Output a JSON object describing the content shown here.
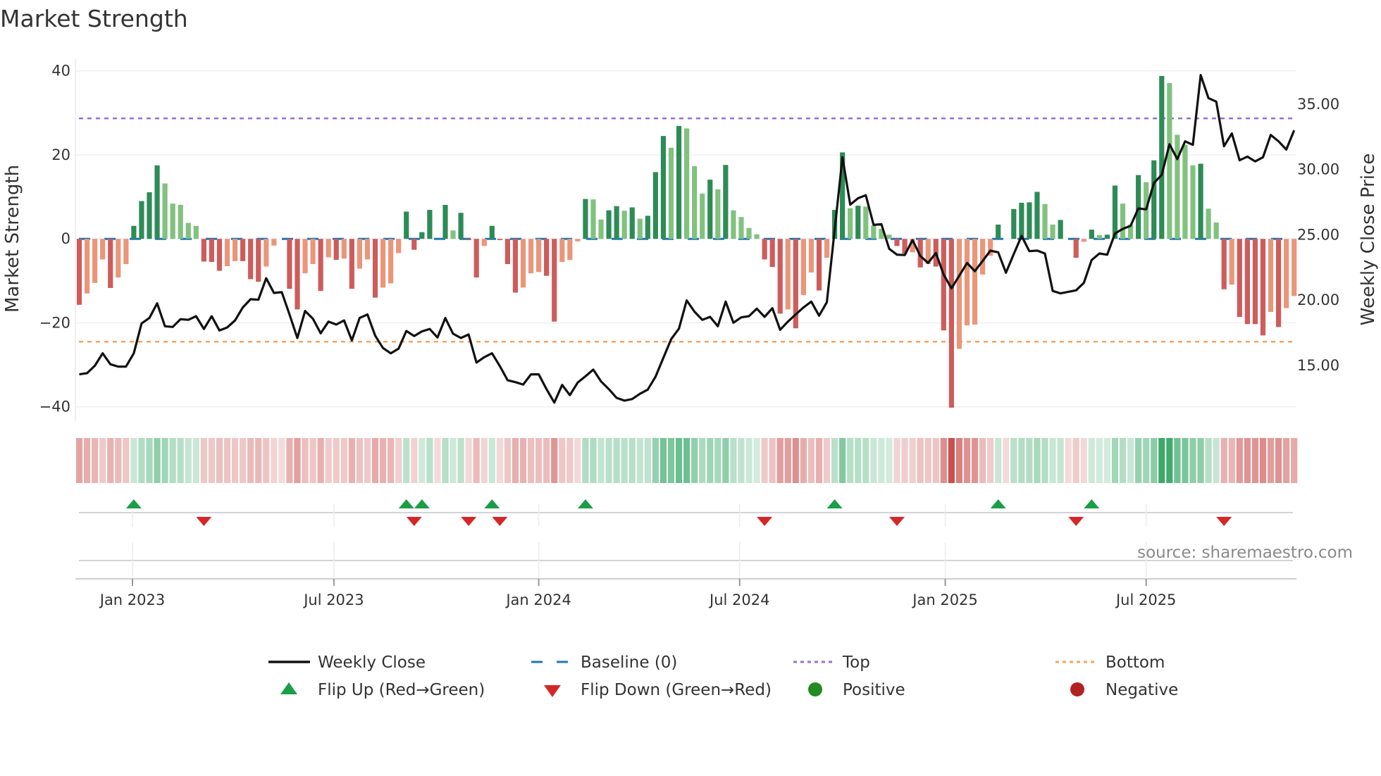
{
  "title": "Market Strength",
  "source": "source: sharemaestro.com",
  "colors": {
    "green_strong": "#2e8b57",
    "green_weak": "#82c17f",
    "red_strong": "#cd5c5c",
    "red_weak": "#e9967a",
    "baseline": "#1f77b4",
    "top": "#9370db",
    "bottom": "#f4a460",
    "close": "#111111",
    "flip_up": "#1a9e46",
    "flip_down": "#d62728",
    "positive": "#228b22",
    "negative": "#b22222",
    "strip_green": "#2ca25f",
    "strip_red": "#c84646"
  },
  "legend": {
    "weekly_close": "Weekly Close",
    "baseline": "Baseline (0)",
    "top": "Top",
    "bottom": "Bottom",
    "flip_up": "Flip Up (Red→Green)",
    "flip_down": "Flip Down (Green→Red)",
    "positive": "Positive",
    "negative": "Negative"
  },
  "chart_data": {
    "type": "bar",
    "title": "Market Strength",
    "ylabel": "Market Strength",
    "ylabel_right": "Weekly Close Price",
    "xlabel": "",
    "ylim": [
      -43.4,
      42.8
    ],
    "ylim_right": [
      10.74,
      38.45
    ],
    "xlim_weeks": [
      -0.5,
      156.3
    ],
    "yticks": [
      {
        "v": 40,
        "label": "40"
      },
      {
        "v": 20,
        "label": "20"
      },
      {
        "v": 0,
        "label": "0"
      },
      {
        "v": -20,
        "label": "−20"
      },
      {
        "v": -40,
        "label": "−40"
      }
    ],
    "yticks_right": [
      {
        "v": 15,
        "label": "15.00"
      },
      {
        "v": 20,
        "label": "20.00"
      },
      {
        "v": 25,
        "label": "25.00"
      },
      {
        "v": 30,
        "label": "30.00"
      },
      {
        "v": 35,
        "label": "35.00"
      }
    ],
    "xticks": [
      {
        "week": 6.83,
        "label": "Jan 2023"
      },
      {
        "week": 32.7,
        "label": "Jul 2023"
      },
      {
        "week": 59,
        "label": "Jan 2024"
      },
      {
        "week": 84.8,
        "label": "Jul 2024"
      },
      {
        "week": 111.2,
        "label": "Jan 2025"
      },
      {
        "week": 137,
        "label": "Jul 2025"
      }
    ],
    "top_level": 28.7,
    "bottom_level": -24.5,
    "baseline": 0,
    "grid": true,
    "legend_position": "bottom",
    "strength": [
      -15.7,
      -13,
      -10.5,
      -4.9,
      -11.7,
      -9.2,
      -6,
      3.1,
      9,
      11.1,
      17.5,
      13.2,
      8.4,
      8.1,
      3.8,
      3.1,
      -5.4,
      -5.5,
      -7.6,
      -6.5,
      -5.3,
      -5.3,
      -9.6,
      -10.2,
      -6.6,
      -1.6,
      0,
      -11.9,
      -16.8,
      -8.2,
      -6,
      -12.4,
      -4.4,
      -5,
      -4.7,
      -11.9,
      -7.1,
      -4.9,
      -14,
      -11.6,
      -10.6,
      -3.4,
      6.5,
      -2.6,
      1.6,
      6.9,
      0,
      8.1,
      2,
      6.2,
      -0.3,
      -9.2,
      -1.7,
      3.1,
      -0.3,
      -6,
      -12.8,
      -11.6,
      -8.2,
      -7.9,
      -8.8,
      -19.7,
      -5.5,
      -5,
      -0.6,
      9.5,
      9.4,
      4.6,
      6.8,
      7.8,
      6.7,
      7.5,
      4.8,
      5.5,
      15.9,
      24.5,
      21.7,
      26.9,
      26.3,
      17.3,
      10.8,
      14.1,
      11.8,
      17.6,
      6.8,
      5.2,
      2.6,
      1.1,
      -4.9,
      -6.7,
      -17.8,
      -16.8,
      -21.3,
      -13.4,
      -8,
      -12.3,
      -4.5,
      6.9,
      20.6,
      7.3,
      7.9,
      7.7,
      3.2,
      2.4,
      1,
      -1.7,
      -3.5,
      -3.2,
      -6.8,
      -6,
      -6.6,
      -21.8,
      -40.2,
      -26.2,
      -20.6,
      -20.4,
      -8.5,
      -4,
      3.4,
      0,
      7.1,
      8.6,
      8.7,
      11.2,
      8.3,
      3.4,
      4.5,
      0,
      -4.5,
      -0.7,
      2.2,
      0.9,
      1,
      12.7,
      8.4,
      3.4,
      15.2,
      13.5,
      18.7,
      38.8,
      37.1,
      24.8,
      22.4,
      17.5,
      17.9,
      7.2,
      3.9,
      -12,
      -10.9,
      -18.6,
      -20.3,
      -20.3,
      -23,
      -17.4,
      -21,
      -16.5,
      -13.6
    ],
    "weekly_close": [
      14.32,
      14.41,
      14.98,
      15.93,
      15.09,
      14.91,
      14.91,
      15.93,
      18.22,
      18.63,
      19.76,
      18.0,
      17.95,
      18.54,
      18.49,
      18.77,
      17.79,
      18.77,
      17.68,
      17.91,
      18.45,
      19.44,
      20.07,
      20.03,
      21.68,
      20.55,
      20.61,
      18.9,
      17.1,
      19.17,
      18.58,
      17.46,
      18.36,
      18.13,
      18.45,
      16.92,
      18.63,
      18.9,
      17.28,
      16.33,
      15.93,
      16.29,
      17.64,
      17.25,
      17.61,
      17.79,
      17.14,
      18.63,
      17.43,
      17.1,
      17.37,
      15.22,
      15.63,
      15.93,
      14.95,
      13.87,
      13.72,
      13.54,
      14.32,
      14.32,
      13.18,
      12.16,
      13.51,
      12.73,
      13.69,
      14.17,
      14.68,
      13.78,
      13.19,
      12.52,
      12.31,
      12.43,
      12.83,
      13.15,
      14.14,
      15.57,
      17.01,
      17.82,
      19.98,
      19.12,
      18.49,
      18.72,
      18.0,
      19.89,
      18.27,
      18.68,
      18.77,
      19.35,
      18.72,
      19.38,
      17.73,
      18.36,
      18.9,
      19.44,
      19.89,
      18.81,
      19.84,
      25.37,
      30.94,
      27.31,
      27.8,
      28.03,
      25.76,
      25.82,
      23.93,
      23.48,
      23.45,
      24.6,
      23.39,
      22.85,
      23.61,
      21.95,
      20.91,
      21.86,
      22.85,
      22.22,
      23.0,
      23.79,
      23.66,
      22.1,
      23.53,
      24.92,
      23.75,
      23.79,
      23.57,
      20.7,
      20.52,
      20.64,
      20.75,
      21.32,
      23.07,
      23.57,
      23.48,
      25.1,
      25.46,
      25.69,
      27.02,
      26.95,
      28.96,
      29.59,
      31.93,
      30.8,
      32.16,
      31.89,
      37.23,
      35.47,
      35.2,
      31.78,
      32.77,
      30.71,
      30.99,
      30.62,
      30.94,
      32.65,
      32.16,
      31.53,
      33.0
    ],
    "flip_up_weeks": [
      7,
      42,
      44,
      53,
      65,
      97,
      118,
      130
    ],
    "flip_down_weeks": [
      16,
      43,
      50,
      54,
      88,
      105,
      128,
      147
    ]
  }
}
